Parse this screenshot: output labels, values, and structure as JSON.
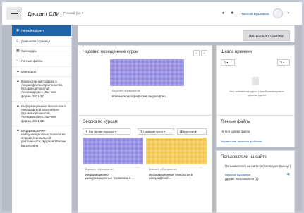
{
  "navbar": {
    "brand": "Дистант СЛИ",
    "language": "Русский (ru) ▾",
    "user_name": "Николай Бушманов"
  },
  "sidebar": {
    "items": [
      {
        "label": "Личный кабинет",
        "icon": "dashboard-icon"
      },
      {
        "label": "Домашняя страница",
        "icon": "home-icon"
      },
      {
        "label": "Календарь",
        "icon": "calendar-icon"
      },
      {
        "label": "Личные файлы",
        "icon": "file-icon"
      },
      {
        "label": "Мои курсы",
        "icon": "graduation-cap-icon"
      },
      {
        "label": "Компьютерная графика в ландшафтном строительстве (Бушманов Николай Александрович, Заочная форма, 2021-22)",
        "icon": "graduation-cap-icon"
      },
      {
        "label": "Информационные технологии в ландшафтной архитектуре (Бушманов Николай Александрович, Заочная форма, 2021-22)",
        "icon": "graduation-cap-icon"
      },
      {
        "label": "Информационно-коммуникационные технологии в профессиональной деятельности (Худяков Максим Васильевич,",
        "icon": "graduation-cap-icon"
      }
    ]
  },
  "main": {
    "customize_button": "Настроить эту страницу",
    "recent_courses": {
      "title": "Недавно посещенные курсы",
      "course": {
        "category": "Высшее образование",
        "name": "Компьютерная графика в ландшафтно..."
      }
    },
    "timeline": {
      "title": "Шкала времени",
      "empty_text": "Нет элементов курса с приближающимся сроком сдачи"
    },
    "overview": {
      "title": "Сводка по курсам",
      "filter": "Все (кроме скрытых) ▾",
      "sort": "Название курса ▾",
      "view": "Карточки ▾",
      "courses": [
        {
          "category": "Высшее образование",
          "name": "Информационно-коммуникационные технологии в ..."
        },
        {
          "category": "Высшее образование",
          "name": "Информационные технологии в ландшафтной ..."
        }
      ]
    },
    "private_files": {
      "title": "Личные файлы",
      "empty": "Нет ни одного файла",
      "manage_link": "Управление личными файлами..."
    },
    "online_users": {
      "title": "Пользователи на сайте",
      "summary": "Пользователей на сайте: 2 (последние 5 минут)",
      "user": "Николай Бушманов",
      "others": "Другие пользователи (1)"
    }
  },
  "colors": {
    "accent": "#1f62a5",
    "course_purple": "#8e87e0",
    "course_yellow": "#f2c64c"
  }
}
